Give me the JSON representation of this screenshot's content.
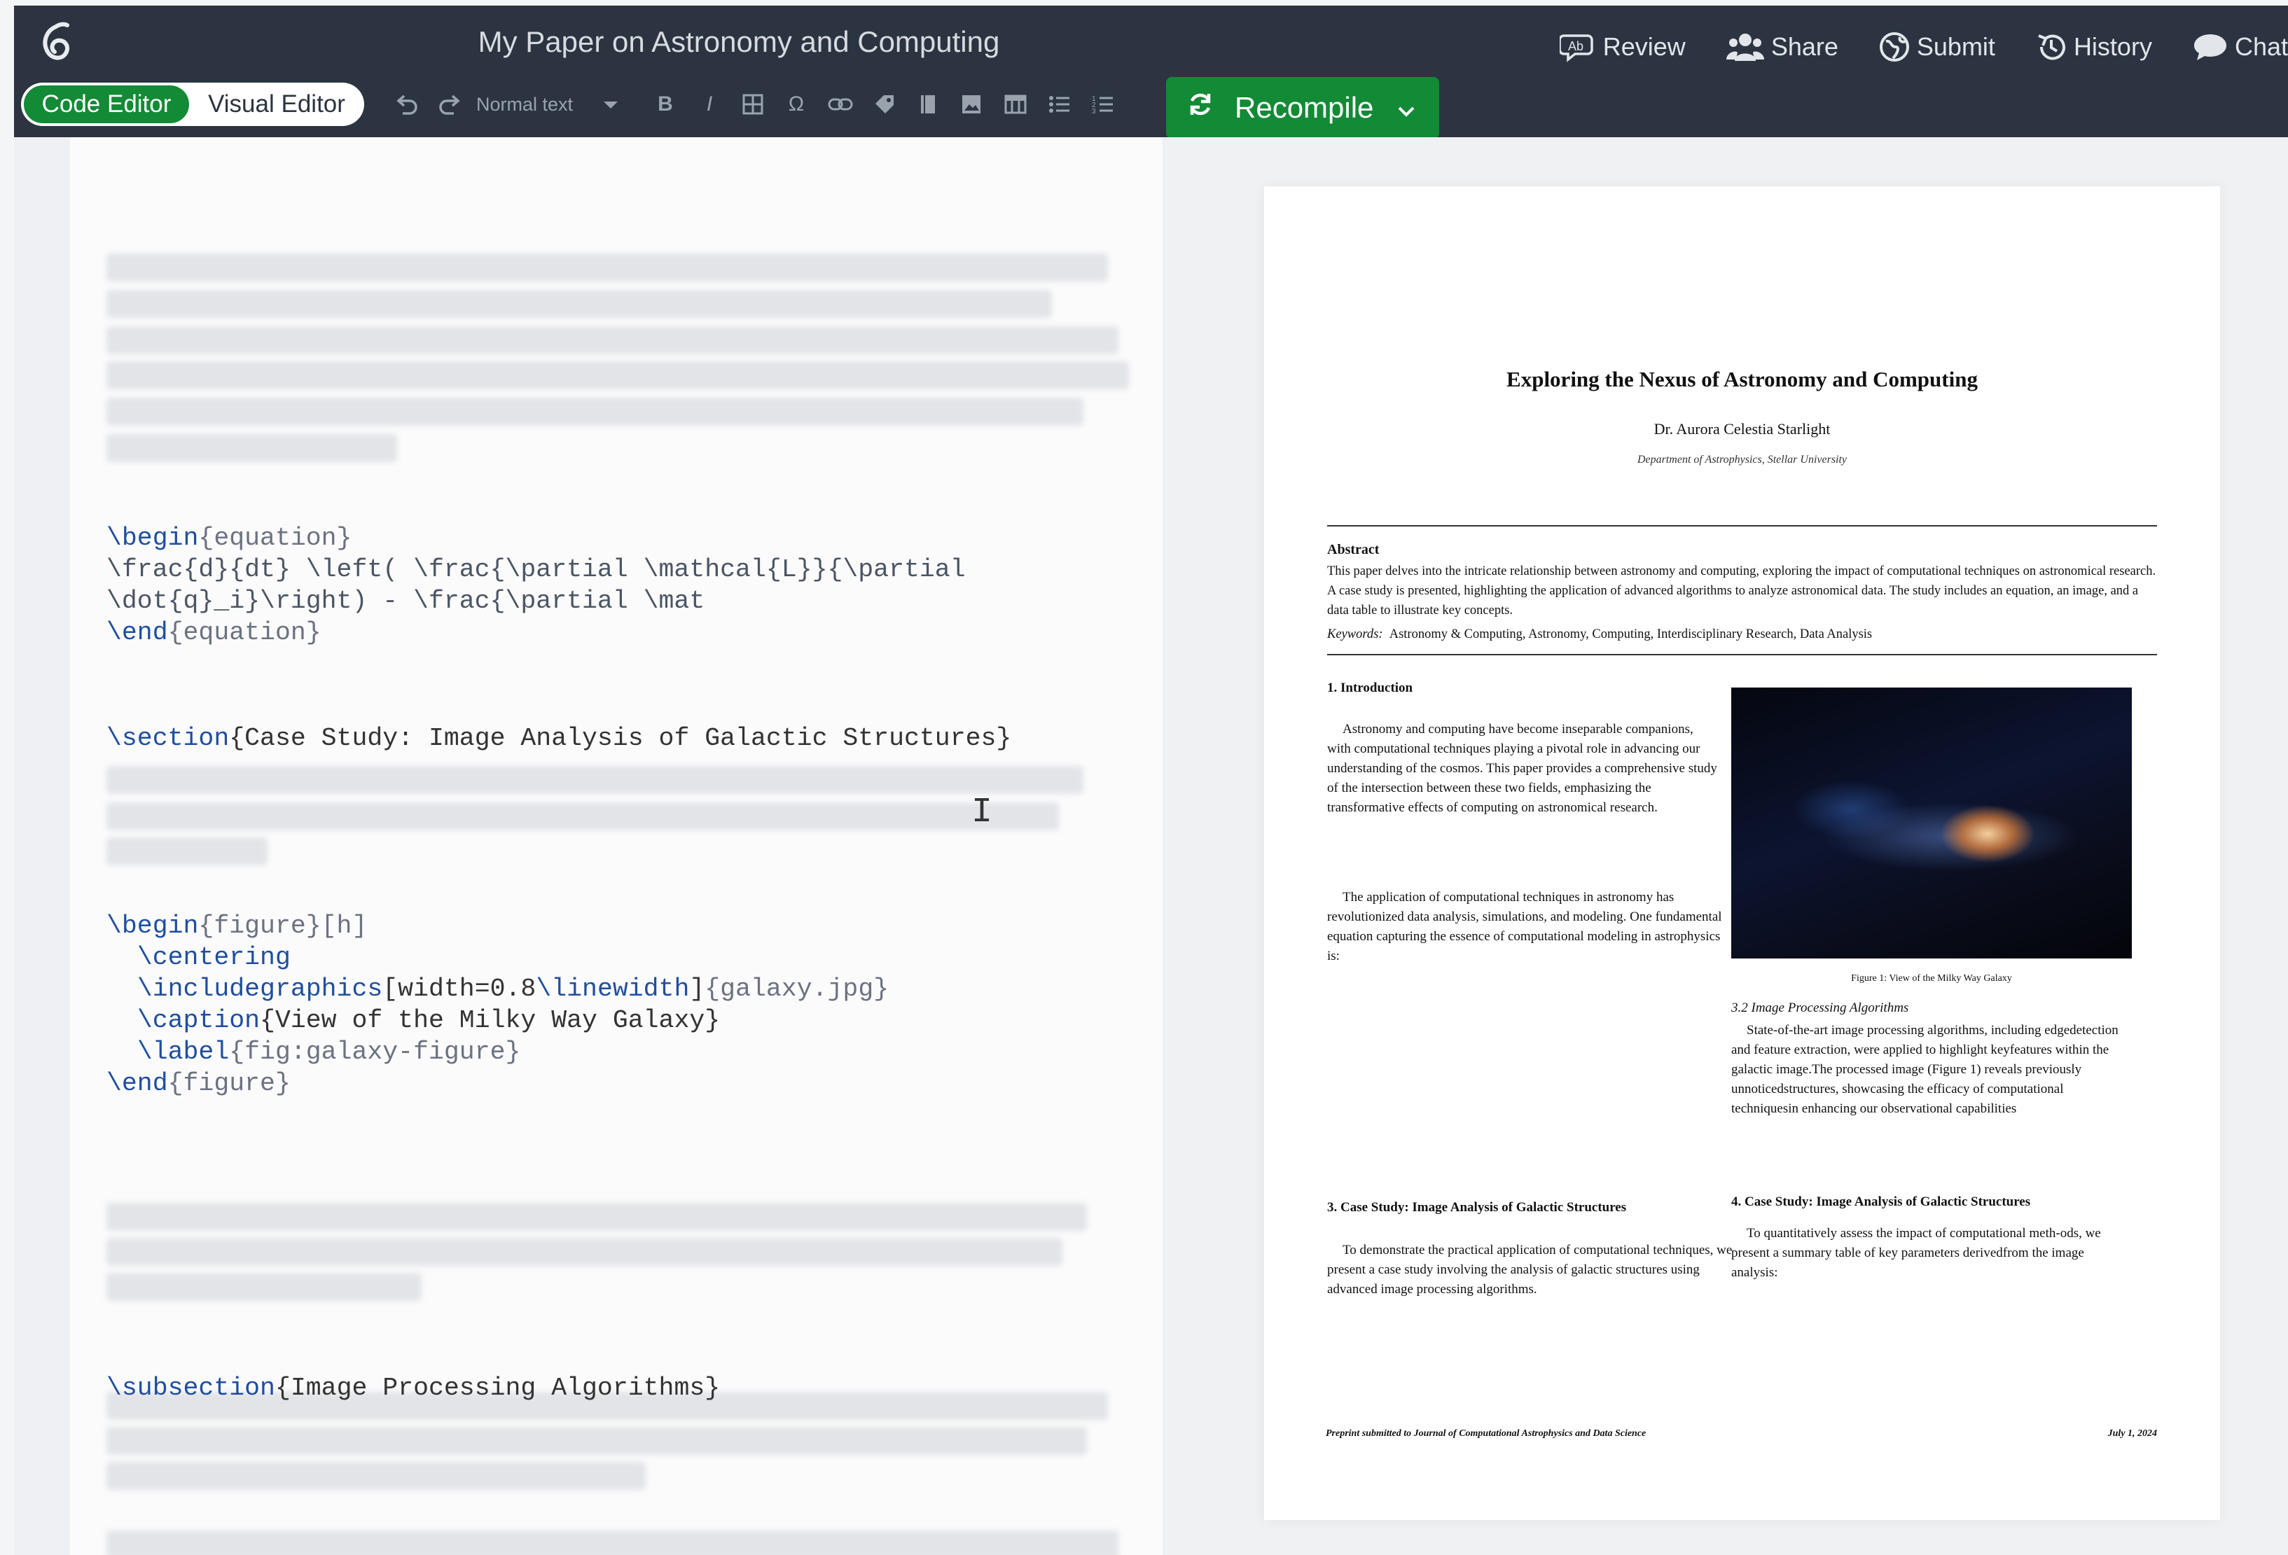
{
  "app": {
    "logo_icon": "overleaf-leaf-icon",
    "document_title": "My Paper on Astronomy and Computing"
  },
  "top_actions": [
    {
      "label": "Review",
      "icon": "review-icon"
    },
    {
      "label": "Share",
      "icon": "share-people-icon"
    },
    {
      "label": "Submit",
      "icon": "globe-icon"
    },
    {
      "label": "History",
      "icon": "history-icon"
    },
    {
      "label": "Chat",
      "icon": "chat-bubble-icon"
    }
  ],
  "toolbar": {
    "code_editor_label": "Code Editor",
    "visual_editor_label": "Visual Editor",
    "text_style": "Normal text",
    "recompile_label": "Recompile",
    "accent": "#138a36"
  },
  "editor": {
    "equation": {
      "begin_cmd": "\\begin",
      "begin_arg": "{equation}",
      "line2": "\\frac{d}{dt} \\left( \\frac{\\partial \\mathcal{L}}{\\partial",
      "line3": "\\dot{q}_i}\\right) - \\frac{\\partial \\mat",
      "end_cmd": "\\end",
      "end_arg": "{equation}"
    },
    "section": {
      "cmd": "\\section",
      "arg": "{Case Study: Image Analysis of Galactic Structures}"
    },
    "figure": {
      "begin_cmd": "\\begin",
      "begin_arg": "{figure}[h]",
      "centering": "\\centering",
      "includegraphics_cmd": "\\includegraphics",
      "includegraphics_opt": "[width=0.8",
      "linewidth_cmd": "\\linewidth",
      "includegraphics_end": "]",
      "includegraphics_arg": "{galaxy.jpg}",
      "caption_cmd": "\\caption",
      "caption_arg": "{View of the Milky Way Galaxy}",
      "label_cmd": "\\label",
      "label_arg": "{fig:galaxy-figure}",
      "end_cmd": "\\end",
      "end_arg": "{figure}"
    },
    "subsection": {
      "cmd": "\\subsection",
      "arg": "{Image Processing Algorithms}"
    }
  },
  "preview": {
    "title": "Exploring the Nexus of Astronomy and Computing",
    "author": "Dr. Aurora Celestia Starlight",
    "affiliation": "Department of Astrophysics, Stellar University",
    "abstract_heading": "Abstract",
    "abstract_text": "This paper delves into the intricate relationship between astronomy and computing, exploring the impact of computational techniques on astronomical research. A case study is presented, highlighting the application of advanced algorithms to analyze astronomical data. The study includes an equation, an image, and a data table to illustrate key concepts.",
    "keywords_label": "Keywords:",
    "keywords": "Astronomy & Computing, Astronomy, Computing, Interdisciplinary Research, Data Analysis",
    "intro_heading": "1. Introduction",
    "intro_p1": "Astronomy and computing have become inseparable companions, with computational techniques playing a pivotal role in advancing our understanding of the cosmos. This paper provides a comprehensive study of the intersection between these two fields, emphasizing the transformative effects of computing on astronomical research.",
    "intro_p2": "The application of computational techniques in astronomy has revolutionized data analysis, simulations, and modeling. One fundamental equation capturing the essence of computational modeling in astrophysics is:",
    "figure_caption": "Figure 1: View of the Milky Way Galaxy",
    "sub32_heading": "3.2  Image Processing Algorithms",
    "sub32_text": "State-of-the-art image processing algorithms, including edgedetection and feature extraction, were applied to highlight keyfeatures within the galactic image.The processed image (Figure 1) reveals previously unnoticedstructures, showcasing the efficacy of computational techniquesin enhancing our observational capabilities",
    "sec3_heading": "3. Case Study: Image Analysis of Galactic Structures",
    "sec3_text": "To demonstrate the practical application of computational techniques, we present a case study involving the analysis of galactic structures using advanced image processing algorithms.",
    "sec4_heading": "4. Case Study: Image Analysis of Galactic Structures",
    "sec4_text": "To quantitatively assess the impact of computational meth-ods, we present a summary table of key parameters derivedfrom the image analysis:",
    "footer_left": "Preprint submitted to Journal of Computational Astrophysics and Data Science",
    "footer_right": "July 1, 2024"
  }
}
